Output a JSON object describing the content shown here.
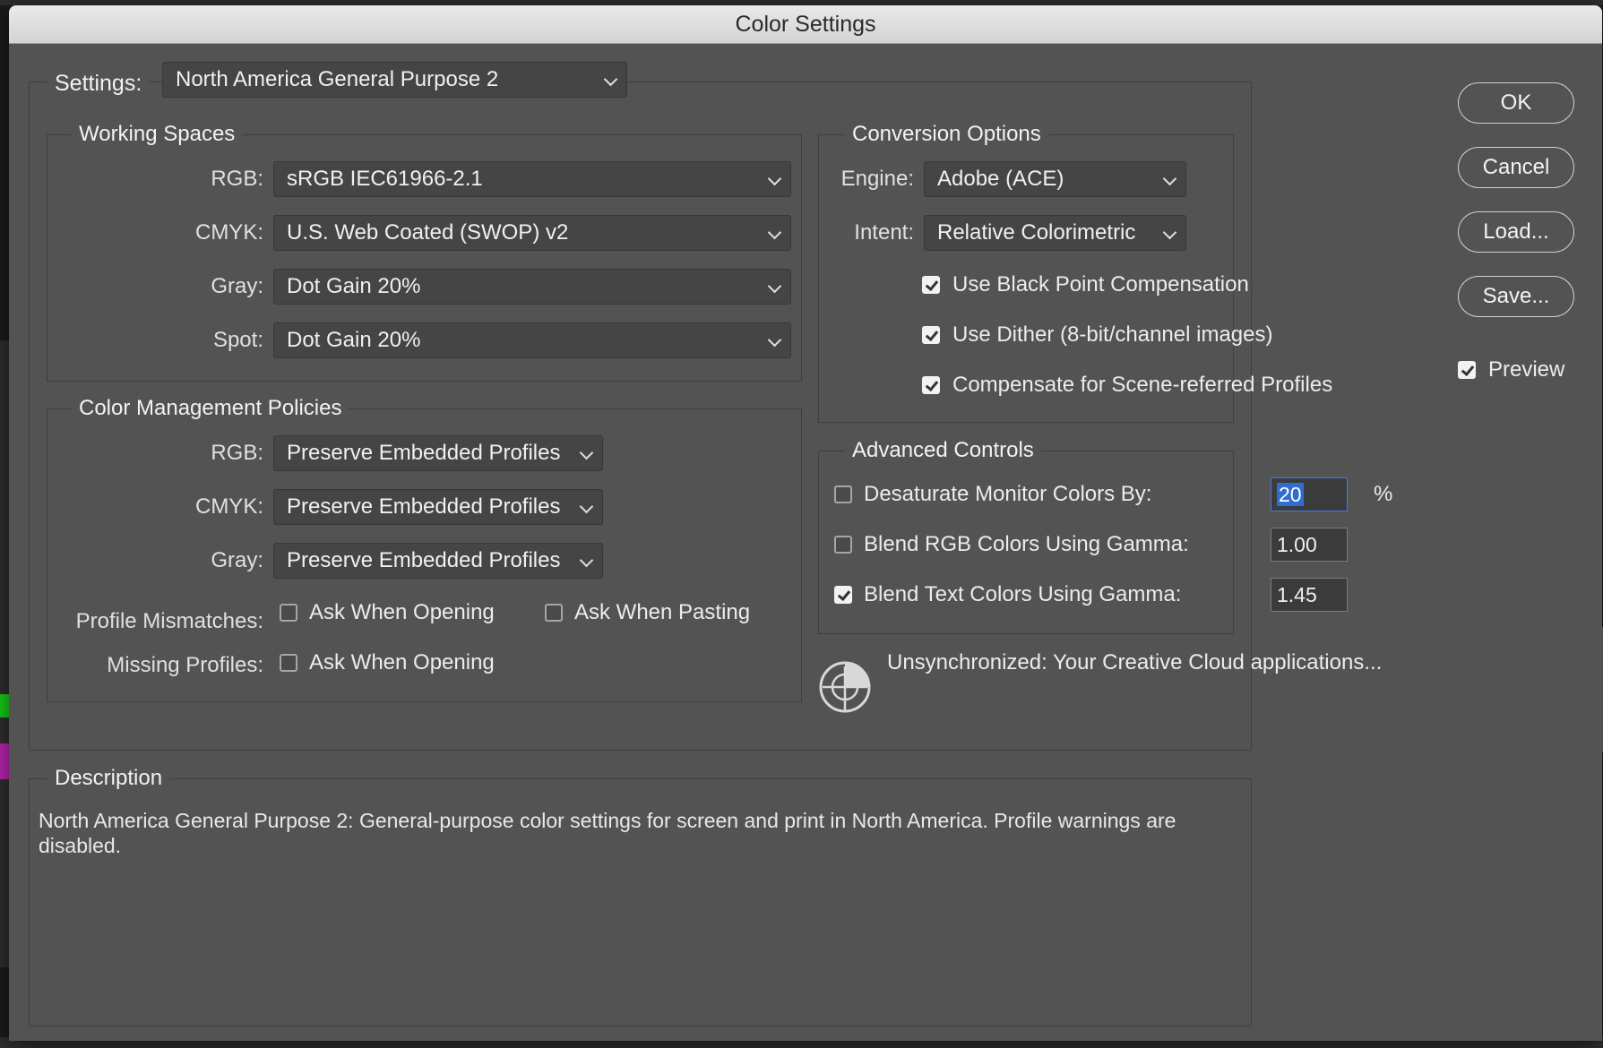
{
  "window": {
    "title": "Color Settings"
  },
  "settings": {
    "label": "Settings:",
    "value": "North America General Purpose 2"
  },
  "working_spaces": {
    "title": "Working Spaces",
    "rows": [
      {
        "label": "RGB:",
        "value": "sRGB IEC61966-2.1"
      },
      {
        "label": "CMYK:",
        "value": "U.S. Web Coated (SWOP) v2"
      },
      {
        "label": "Gray:",
        "value": "Dot Gain 20%"
      },
      {
        "label": "Spot:",
        "value": "Dot Gain 20%"
      }
    ]
  },
  "policies": {
    "title": "Color Management Policies",
    "rows": [
      {
        "label": "RGB:",
        "value": "Preserve Embedded Profiles"
      },
      {
        "label": "CMYK:",
        "value": "Preserve Embedded Profiles"
      },
      {
        "label": "Gray:",
        "value": "Preserve Embedded Profiles"
      }
    ],
    "profile_mismatches": {
      "label": "Profile Mismatches:",
      "ask_opening": {
        "label": "Ask When Opening",
        "checked": false
      },
      "ask_pasting": {
        "label": "Ask When Pasting",
        "checked": false
      }
    },
    "missing_profiles": {
      "label": "Missing Profiles:",
      "ask_opening": {
        "label": "Ask When Opening",
        "checked": false
      }
    }
  },
  "conversion": {
    "title": "Conversion Options",
    "engine": {
      "label": "Engine:",
      "value": "Adobe (ACE)"
    },
    "intent": {
      "label": "Intent:",
      "value": "Relative Colorimetric"
    },
    "black_point": {
      "label": "Use Black Point Compensation",
      "checked": true
    },
    "dither": {
      "label": "Use Dither (8-bit/channel images)",
      "checked": true
    },
    "scene_referred": {
      "label": "Compensate for Scene-referred Profiles",
      "checked": true
    }
  },
  "advanced": {
    "title": "Advanced Controls",
    "desaturate": {
      "label": "Desaturate Monitor Colors By:",
      "checked": false,
      "value": "20",
      "unit": "%"
    },
    "blend_rgb": {
      "label": "Blend RGB Colors Using Gamma:",
      "checked": false,
      "value": "1.00"
    },
    "blend_text": {
      "label": "Blend Text Colors Using Gamma:",
      "checked": true,
      "value": "1.45"
    }
  },
  "sync": {
    "text": "Unsynchronized: Your Creative Cloud applications...",
    "icon": "unsynchronized-icon"
  },
  "description": {
    "title": "Description",
    "text": "North America General Purpose 2:  General-purpose color settings for screen and print in North America. Profile warnings are disabled."
  },
  "buttons": {
    "ok": "OK",
    "cancel": "Cancel",
    "load": "Load...",
    "save": "Save..."
  },
  "preview": {
    "label": "Preview",
    "checked": true
  },
  "colors": {
    "dialog_bg": "#535353",
    "titlebar": "#dcdcdc",
    "selection": "#2f6dd3"
  }
}
